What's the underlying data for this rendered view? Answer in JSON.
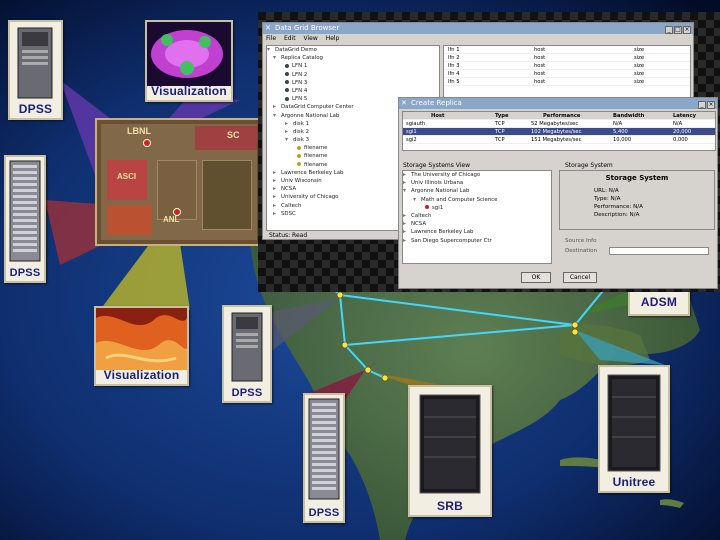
{
  "labels": {
    "dpss_1": "DPSS",
    "dpss_2": "DPSS",
    "dpss_3": "DPSS",
    "dpss_4": "DPSS",
    "visualization_1": "Visualization",
    "visualization_2": "Visualization",
    "adsm": "ADSM",
    "srb": "SRB",
    "unitree": "Unitree"
  },
  "chip": {
    "lbnl": "LBNL",
    "anl": "ANL",
    "asci": "ASCI",
    "sc": "SC"
  },
  "grid_browser": {
    "title": "Data Grid Browser",
    "menu": [
      "File",
      "Edit",
      "View",
      "Help"
    ],
    "tree": [
      "DataGrid Demo",
      "Replica Catalog",
      "LFN 1",
      "LFN 2",
      "LFN 3",
      "LFN 4",
      "LFN 5",
      "DataGrid Computer Center",
      "Argonne National Lab",
      "disk 1",
      "disk 2",
      "disk 3",
      "filename",
      "filename",
      "filename",
      "Lawrence Berkeley Lab",
      "Univ Wisconsin",
      "NCSA",
      "University of Chicago",
      "Caltech",
      "SDSC"
    ],
    "status": "Status: Read",
    "list": [
      [
        "lfn 1",
        "host",
        "size"
      ],
      [
        "lfn 2",
        "host",
        "size"
      ],
      [
        "lfn 3",
        "host",
        "size"
      ],
      [
        "lfn 4",
        "host",
        "size"
      ],
      [
        "lfn 5",
        "host",
        "size"
      ]
    ]
  },
  "replica_window": {
    "title": "Create Replica",
    "columns": [
      "Host",
      "Type",
      "Performance",
      "Bandwidth",
      "Latency"
    ],
    "rows": [
      [
        "sgiauth",
        "TCP",
        "52 Megabytes/sec",
        "N/A",
        "N/A"
      ],
      [
        "sgi1",
        "TCP",
        "102 Megabytes/sec",
        "5,400",
        "20,000"
      ],
      [
        "sgi2",
        "TCP",
        "151 Megabytes/sec",
        "10,000",
        "0,000"
      ]
    ],
    "left_panel_title": "Storage Systems View",
    "right_panel_title": "Storage System",
    "tree": [
      "The University of Chicago",
      "Univ Illinois Urbana",
      "Argonne National Lab",
      "Math and Computer Science",
      "sgi1",
      "Caltech",
      "NCSA",
      "Lawrence Berkeley Lab",
      "San Diego Supercomputer Ctr"
    ],
    "details": [
      "URL: N/A",
      "Type: N/A",
      "Performance: N/A",
      "Description: N/A"
    ],
    "source_label": "Source Info",
    "dest_label": "Destination",
    "ok": "OK",
    "cancel": "Cancel"
  }
}
